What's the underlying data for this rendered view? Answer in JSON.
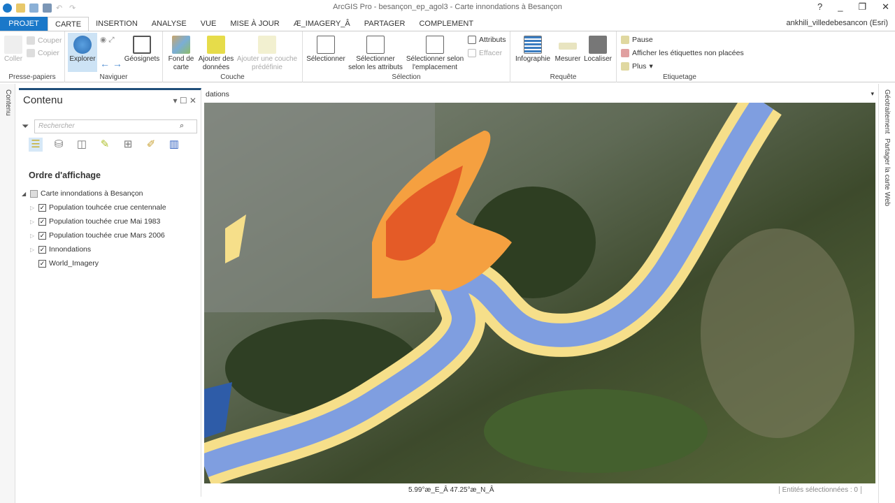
{
  "app": {
    "title": "ArcGIS Pro - besançon_ep_agol3 - Carte innondations à Besançon",
    "user": "ankhili_villedebesancon (Esri)"
  },
  "tabs": [
    "PROJET",
    "CARTE",
    "INSERTION",
    "ANALYSE",
    "VUE",
    "MISE À JOUR",
    "Æ_IMAGERY_Â",
    "PARTAGER",
    "COMPLEMENT"
  ],
  "ribbon": {
    "clipboard": {
      "label": "Presse-papiers",
      "coller": "Coller",
      "couper": "Couper",
      "copier": "Copier"
    },
    "navigate": {
      "label": "Naviguer",
      "explorer": "Explorer",
      "geosignets": "Géosignets"
    },
    "layer": {
      "label": "Couche",
      "fond": "Fond de carte",
      "ajouter": "Ajouter des données",
      "couche": "Ajouter une couche prédéfinie"
    },
    "selection": {
      "label": "Sélection",
      "select": "Sélectionner",
      "attr": "Sélectionner selon les attributs",
      "loc": "Sélectionner selon l'emplacement",
      "attributs": "Attributs",
      "effacer": "Effacer"
    },
    "query": {
      "label": "Requête",
      "info": "Infographie",
      "mesurer": "Mesurer",
      "localiser": "Localiser"
    },
    "labeling": {
      "label": "Etiquetage",
      "pause": "Pause",
      "afficher": "Afficher les étiquettes non placées",
      "plus": "Plus"
    }
  },
  "left_tab": "Contenu",
  "contents": {
    "title": "Contenu",
    "search_placeholder": "Rechercher",
    "order": "Ordre d'affichage",
    "map": "Carte innondations à Besançon",
    "layers": [
      "Population touhcée crue centennale",
      "Population touchée crue Mai 1983",
      "Population touchée crue Mars 2006",
      "Innondations",
      "World_Imagery"
    ]
  },
  "map_tab": "dations",
  "right_tabs": [
    "Géotraitement",
    "Partager la carte Web"
  ],
  "status": {
    "coords": "5.99°æ_E_Â 47.25°æ_N_Â",
    "selected": "Entités sélectionnées : 0"
  }
}
